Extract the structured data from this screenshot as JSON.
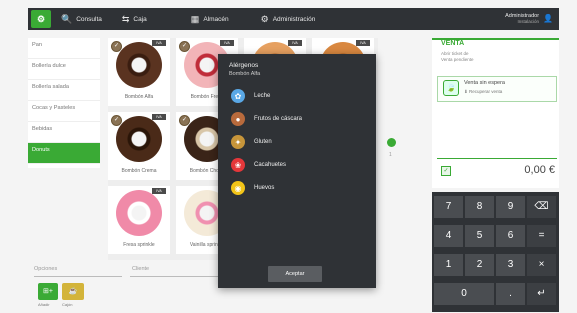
{
  "topbar": {
    "logo_glyph": "⚙",
    "nav": [
      {
        "label": "Consulta",
        "icon": "search-icon",
        "glyph": "🔍"
      },
      {
        "label": "Caja",
        "icon": "swap-arrows-icon",
        "glyph": "⇆"
      },
      {
        "label": "Almacén",
        "icon": "store-icon",
        "glyph": "▦"
      },
      {
        "label": "Administración",
        "icon": "gear-icon",
        "glyph": "⚙"
      }
    ],
    "user_name": "Administrador",
    "user_sub": "Instalación",
    "user_glyph": "👤"
  },
  "categories": [
    {
      "label": "Pan",
      "active": false
    },
    {
      "label": "Bollería dulce",
      "active": false
    },
    {
      "label": "Bollería salada",
      "active": false
    },
    {
      "label": "Cocas y Pasteles",
      "active": false
    },
    {
      "label": "Bebidas",
      "active": false
    },
    {
      "label": "Donuts",
      "active": true
    }
  ],
  "products": [
    {
      "name": "Bombón Alfa",
      "badge": "IVA",
      "color": "#5a3320",
      "swirl": "#3a1d10",
      "tick": true
    },
    {
      "name": "Bombón Fresa",
      "badge": "IVA",
      "color": "#f2b4b8",
      "swirl": "#c02d3a",
      "tick": true
    },
    {
      "name": "",
      "badge": "IVA",
      "color": "#e6a060",
      "swirl": "#c07030",
      "tick": false
    },
    {
      "name": "",
      "badge": "IVA",
      "color": "#d98840",
      "swirl": "#b06020",
      "tick": false
    },
    {
      "name": "Bombón Crema",
      "badge": "IVA",
      "color": "#4a2a18",
      "swirl": "#2a1508",
      "tick": true
    },
    {
      "name": "Bombón Choco",
      "badge": "IVA",
      "color": "#3a2418",
      "swirl": "#d8c6a8",
      "tick": true
    },
    {
      "name": "Fresa sprinkle",
      "badge": "IVA",
      "color": "#f08aa8",
      "swirl": "#ffffff",
      "tick": false
    },
    {
      "name": "Vainilla sprinkle",
      "badge": "IVA",
      "color": "#f4ead8",
      "swirl": "#f090b0",
      "tick": false
    }
  ],
  "bottom": {
    "label_left": "Opciones",
    "label_right": "Cliente",
    "add_glyph": "⊞+",
    "cup_glyph": "☕",
    "btn1_label": "Añadir",
    "btn2_label": "Cajón"
  },
  "pager": {
    "label": "1"
  },
  "right": {
    "title": "VENTA",
    "sub1": "Abrir ticket de",
    "sub2": "Venta pendiente",
    "ticket_glyph": "🍃",
    "ticket_name": "Venta sin espera",
    "ticket_sub": "⬇ Recuperar venta",
    "check_glyph": "✓",
    "price": "0,00 €"
  },
  "keypad": {
    "keys": [
      {
        "label": "7",
        "dark": false
      },
      {
        "label": "8",
        "dark": false
      },
      {
        "label": "9",
        "dark": false
      },
      {
        "label": "⌫",
        "dark": true
      },
      {
        "label": "4",
        "dark": false
      },
      {
        "label": "5",
        "dark": false
      },
      {
        "label": "6",
        "dark": false
      },
      {
        "label": "=",
        "dark": true
      },
      {
        "label": "1",
        "dark": false
      },
      {
        "label": "2",
        "dark": false
      },
      {
        "label": "3",
        "dark": false
      },
      {
        "label": "×",
        "dark": true
      },
      {
        "label": "0",
        "dark": false,
        "wide": true
      },
      {
        "label": ".",
        "dark": false
      },
      {
        "label": "↵",
        "dark": true
      }
    ]
  },
  "popup": {
    "title": "Alérgenos",
    "subtitle": "Bombón Alfa",
    "allergens": [
      {
        "label": "Leche",
        "color": "#5aa8e6",
        "glyph": "✿",
        "icon": "milk-icon"
      },
      {
        "label": "Frutos de cáscara",
        "color": "#b86a3c",
        "glyph": "●",
        "icon": "nut-icon"
      },
      {
        "label": "Gluten",
        "color": "#c7953a",
        "glyph": "✦",
        "icon": "wheat-icon"
      },
      {
        "label": "Cacahuetes",
        "color": "#e4373a",
        "glyph": "❀",
        "icon": "peanut-icon"
      },
      {
        "label": "Huevos",
        "color": "#f2c418",
        "glyph": "◉",
        "icon": "egg-icon"
      }
    ],
    "button": "Aceptar"
  }
}
